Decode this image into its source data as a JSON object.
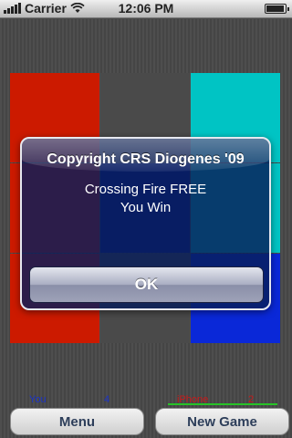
{
  "status_bar": {
    "carrier": "Carrier",
    "time": "12:06 PM",
    "signal_icon": "signal-bars-icon",
    "wifi_icon": "wifi-icon",
    "battery_icon": "battery-icon"
  },
  "board": {
    "cells": [
      {
        "color": "#cc1a00"
      },
      {
        "color": "#4a4a4a"
      },
      {
        "color": "#00c4c4"
      },
      {
        "color": "#cc1a00"
      },
      {
        "color": "#0a1a8a"
      },
      {
        "color": "#00c4c4"
      },
      {
        "color": "#cc1a00"
      },
      {
        "color": "#4a4a4a"
      },
      {
        "color": "#0a28d8"
      }
    ]
  },
  "score": {
    "you_label": "You",
    "you_score": "4",
    "iphone_label": "iPhone",
    "iphone_score": "2"
  },
  "buttons": {
    "menu": "Menu",
    "new_game": "New Game"
  },
  "alert": {
    "title": "Copyright CRS Diogenes '09",
    "line1": "Crossing Fire FREE",
    "line2": "You Win",
    "ok": "OK"
  }
}
